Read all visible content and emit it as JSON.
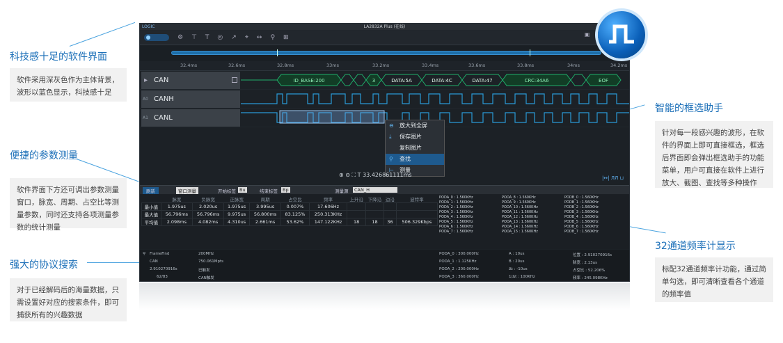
{
  "callouts": [
    {
      "title": "科技感十足的软件界面",
      "body": "软件采用深灰色作为主体背景，波形以蓝色显示，科技感十足"
    },
    {
      "title": "便捷的参数测量",
      "body": "软件界面下方还可调出参数测量窗口，脉宽、周期、占空比等测量参数，同时还支持各项测量参数的统计测量"
    },
    {
      "title": "强大的协议搜索",
      "body": "对于已经解码后的海量数据，只需设置好对应的搜索条件，即可捕获所有的兴趣数据"
    },
    {
      "title": "智能的框选助手",
      "body": "针对每一段感兴趣的波形，在软件的界面上即可直接框选，框选后界面即会弹出框选助手的功能菜单，用户可直接在软件上进行放大、截图、查找等多种操作"
    },
    {
      "title": "32通道频率计显示",
      "body": "标配32通道频率计功能，通过简单勾选，即可清晰查看各个通道的频率值"
    }
  ],
  "app": {
    "title": "LA2832A Plus (在线)",
    "logo": "LOGIC",
    "time_ticks": [
      "32.4ms",
      "32.6ms",
      "32.8ms",
      "33ms",
      "33.2ms",
      "33.4ms",
      "33.6ms",
      "33.8ms",
      "34ms",
      "34.2ms"
    ],
    "channels": [
      {
        "label": "CAN",
        "num": ""
      },
      {
        "label": "CANH",
        "num": "A0"
      },
      {
        "label": "CANL",
        "num": "A1"
      }
    ],
    "decode": [
      "ID_BASE:200",
      "3",
      "DATA:5A",
      "DATA:4C",
      "DATA:47",
      "CRC:34A6",
      "EOF"
    ],
    "context_menu": [
      "放大到全屏",
      "保存图片",
      "复制图片",
      "查找",
      "测量"
    ],
    "cursor_time": "33.426861111ms",
    "measure": {
      "refresh": "刷新",
      "window": "窗口测量",
      "start_label": "开始标签",
      "end_label": "结束标签",
      "start_val": "Bu",
      "end_val": "Bp",
      "source_label": "测量源",
      "source": "CAN_H",
      "headers": [
        "",
        "脉宽",
        "负脉宽",
        "正脉宽",
        "周期",
        "占空比",
        "频率",
        "上升沿",
        "下降沿",
        "边沿",
        "波特率"
      ],
      "rows": [
        [
          "最小值",
          "1.975us",
          "2.020us",
          "1.975us",
          "3.995us",
          "0.007%",
          "17.606Hz",
          "",
          "",
          "",
          ""
        ],
        [
          "最大值",
          "56.796ms",
          "56.796ms",
          "9.975us",
          "56.800ms",
          "83.125%",
          "250.313KHz",
          "",
          "",
          "",
          ""
        ],
        [
          "平均值",
          "2.098ms",
          "4.082ms",
          "4.310us",
          "2.661ms",
          "53.62%",
          "147.122KHz",
          "18",
          "18",
          "36",
          "506.329Kbps"
        ]
      ]
    },
    "freq_rows": [
      [
        "PODA_0 : 1.560KHz",
        "PODA_8 : 1.560KHz",
        "PODB_0 : 1.560KHz"
      ],
      [
        "PODA_1 : 1.560KHz",
        "PODA_9 : 1.560KHz",
        "PODB_1 : 1.560KHz"
      ],
      [
        "PODA_2 : 1.560KHz",
        "PODA_10 : 1.560KHz",
        "PODB_2 : 1.560KHz"
      ],
      [
        "PODA_3 : 1.560KHz",
        "PODA_11 : 1.560KHz",
        "PODB_3 : 1.560KHz"
      ],
      [
        "PODA_4 : 1.560KHz",
        "PODA_12 : 1.560KHz",
        "PODB_4 : 1.560KHz"
      ],
      [
        "PODA_5 : 1.560KHz",
        "PODA_13 : 1.560KHz",
        "PODB_5 : 1.560KHz"
      ],
      [
        "PODA_6 : 1.560KHz",
        "PODA_14 : 1.560KHz",
        "PODB_6 : 1.560KHz"
      ],
      [
        "PODA_7 : 1.560KHz",
        "PODA_15 : 1.560KHz",
        "PODB_7 : 1.560KHz"
      ]
    ],
    "proto": {
      "find": "FrameFind",
      "ch": "CAN",
      "time": "2.910270916s",
      "page": "62/83",
      "rate": "200MHz",
      "depth": "750.061Mpts",
      "status": "已触发",
      "trig": "CAN触发",
      "pa0": "PODA_0 : 300.000Hz",
      "pa1": "PODA_1 : 1.125KHz",
      "pa2": "PODA_2 : 200.000Hz",
      "pa3": "PODA_3 : 360.000Hz",
      "a": "A : 10us",
      "b": "B : 20us",
      "dt": "Δt : -10us",
      "idt": "1/Δt : 100KHz",
      "pos": "位置 : 2.910270916s",
      "width": "脉宽 : 2.13us",
      "duty": "占空比 : 52.206%",
      "freq": "频率 : 245.098KHz"
    }
  }
}
